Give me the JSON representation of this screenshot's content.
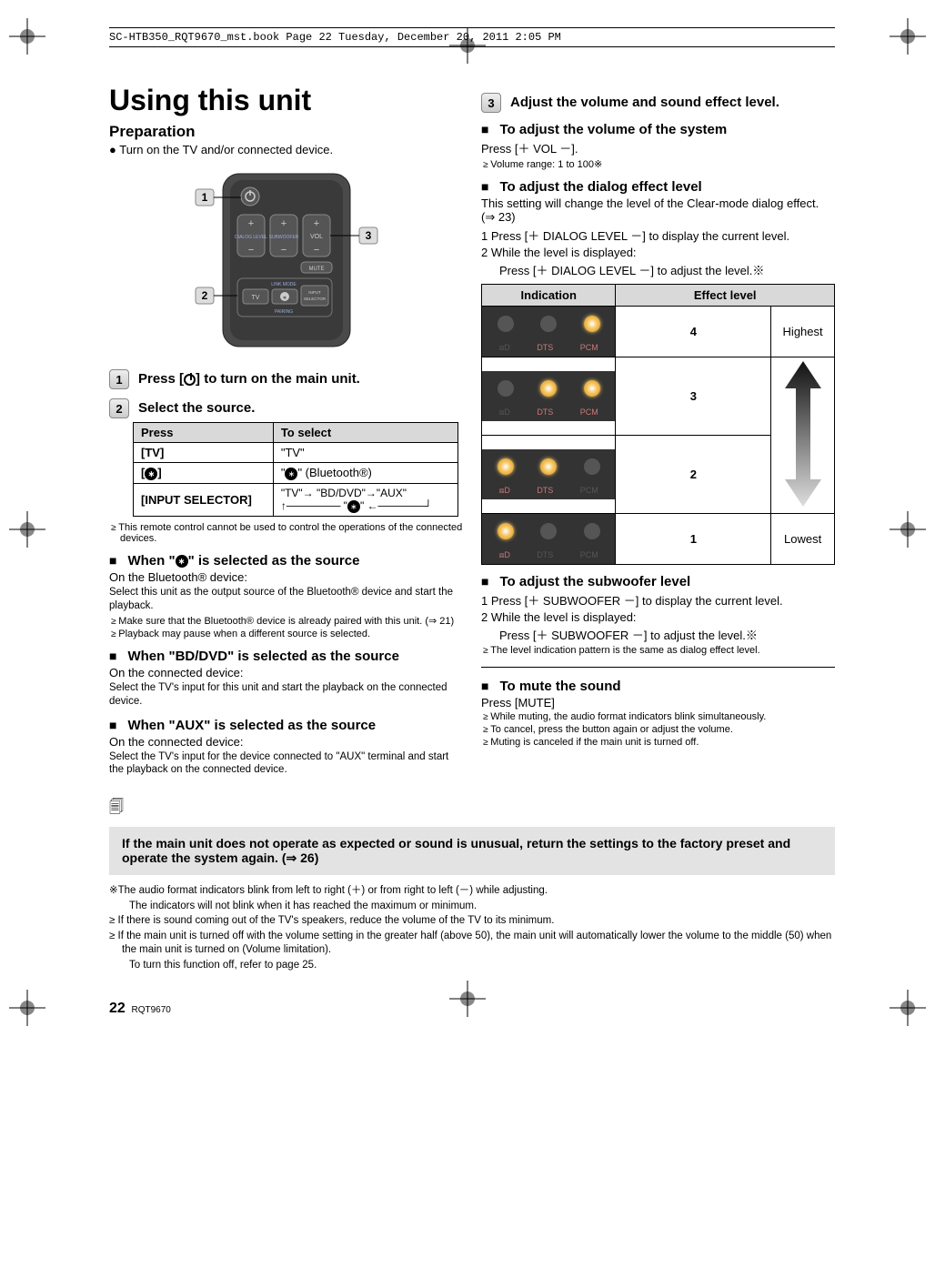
{
  "book_header": "SC-HTB350_RQT9670_mst.book  Page 22  Tuesday, December 20, 2011  2:05 PM",
  "title": "Using this unit",
  "preparation": {
    "heading": "Preparation",
    "line": "Turn on the TV and/or connected device."
  },
  "remote": {
    "labels": {
      "dialog": "DIALOG LEVEL",
      "sub": "SUBWOOFER",
      "vol": "VOL",
      "mute": "MUTE",
      "linkmode": "LINK MODE",
      "input_selector": "INPUT SELECTOR",
      "pairing": "PAIRING",
      "tv": "TV"
    }
  },
  "steps": {
    "s1_pre": "Press [",
    "s1_post": "] to turn on the main unit.",
    "s2": "Select the source.",
    "s3": "Adjust the volume and sound effect level."
  },
  "source_table": {
    "h_press": "Press",
    "h_select": "To select",
    "rows": [
      {
        "press": "[TV]",
        "select": "\"TV\""
      },
      {
        "press_pre": "[",
        "press_post": "]",
        "select_pre": "\"",
        "select_post": "\" (Bluetooth®)"
      },
      {
        "press": "[INPUT SELECTOR]",
        "select_line1": "\"TV\"→ \"BD/DVD\"→\"AUX\"",
        "select_line2_pre": "↑─────── \"",
        "select_line2_post": "\" ←──────┘"
      }
    ]
  },
  "remote_note": "This remote control cannot be used to control the operations of the connected devices.",
  "src_bt": {
    "h_pre": "When \"",
    "h_post": "\" is selected as the source",
    "line1": "On the Bluetooth® device:",
    "line2": "Select this unit as the output source of the Bluetooth® device and start the playback.",
    "b1": "Make sure that the Bluetooth® device is already paired with this unit. (⇒ 21)",
    "b2": "Playback may pause when a different source is selected."
  },
  "src_bd": {
    "h": "When \"BD/DVD\" is selected as the source",
    "line1": "On the connected device:",
    "line2": "Select the TV's input for this unit and start the playback on the connected device."
  },
  "src_aux": {
    "h": "When \"AUX\" is selected as the source",
    "line1": "On the connected device:",
    "line2": "Select the TV's input for the device connected to \"AUX\" terminal and start the playback on the connected device."
  },
  "vol": {
    "h": "To adjust the volume of the system",
    "line": "Press [＋ VOL －].",
    "note": "Volume range: 1 to 100※"
  },
  "dialog": {
    "h": "To adjust the dialog effect level",
    "intro": "This setting will change the level of the Clear-mode dialog effect. (⇒ 23)",
    "n1": "1   Press [＋ DIALOG LEVEL －] to display the current level.",
    "n2a": "2   While the level is displayed:",
    "n2b": "Press [＋ DIALOG LEVEL －] to adjust the level.※"
  },
  "effect_table": {
    "h_ind": "Indication",
    "h_eff": "Effect level",
    "rows": [
      {
        "num": "4",
        "label": "Highest"
      },
      {
        "num": "3",
        "label": ""
      },
      {
        "num": "2",
        "label": ""
      },
      {
        "num": "1",
        "label": "Lowest"
      }
    ],
    "strip_labels": {
      "dd": "⧈D",
      "dts": "DTS",
      "pcm": "PCM"
    }
  },
  "subw": {
    "h": "To adjust the subwoofer level",
    "n1": "1   Press [＋ SUBWOOFER －] to display the current level.",
    "n2a": "2   While the level is displayed:",
    "n2b": "Press [＋ SUBWOOFER －] to adjust the level.※",
    "note": "The level indication pattern is the same as dialog effect level."
  },
  "mute": {
    "h": "To mute the sound",
    "line": "Press [MUTE]",
    "b1": "While muting, the audio format indicators blink simultaneously.",
    "b2": "To cancel, press the button again or adjust the volume.",
    "b3": "Muting is canceled if the main unit is turned off."
  },
  "notebox": "If the main unit does not operate as expected or sound is unusual, return the settings to the factory preset and operate the system again. (⇒ 26)",
  "footnotes": {
    "f1a": "※The audio format indicators blink from left to right (＋) or from right to left (－) while adjusting.",
    "f1b": "The indicators will not blink when it has reached the maximum or minimum.",
    "f2": "≥ If there is sound coming out of the TV's speakers, reduce the volume of the TV to its minimum.",
    "f3a": "≥ If the main unit is turned off with the volume setting in the greater half (above 50), the main unit will automatically lower the volume to the middle (50) when the main unit is turned on (Volume limitation).",
    "f3b": "To turn this function off, refer to page 25."
  },
  "page": {
    "num": "22",
    "code": "RQT9670"
  }
}
